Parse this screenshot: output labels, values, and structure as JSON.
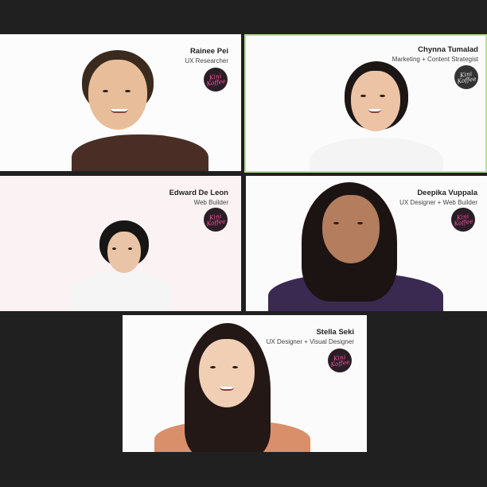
{
  "participants": [
    {
      "name": "Rainee Pei",
      "role": "UX Researcher",
      "logo_text": "Kini\nKoffee"
    },
    {
      "name": "Chynna Tumalad",
      "role": "Marketing + Content Strategist",
      "logo_text": "Kini\nKoffee"
    },
    {
      "name": "Edward De Leon",
      "role": "Web Builder",
      "logo_text": "Kini\nKoffee"
    },
    {
      "name": "Deepika Vuppala",
      "role": "UX Designer + Web Builder",
      "logo_text": "Kini\nKoffee"
    },
    {
      "name": "Stella Seki",
      "role": "UX Designer + Visual Designer",
      "logo_text": "Kini\nKoffee"
    }
  ],
  "colors": {
    "background": "#202020",
    "active_speaker_border": "#b9de93",
    "logo_pink": "#ff4fa0"
  },
  "icons": {
    "logo": "kini-koffee-logo"
  }
}
